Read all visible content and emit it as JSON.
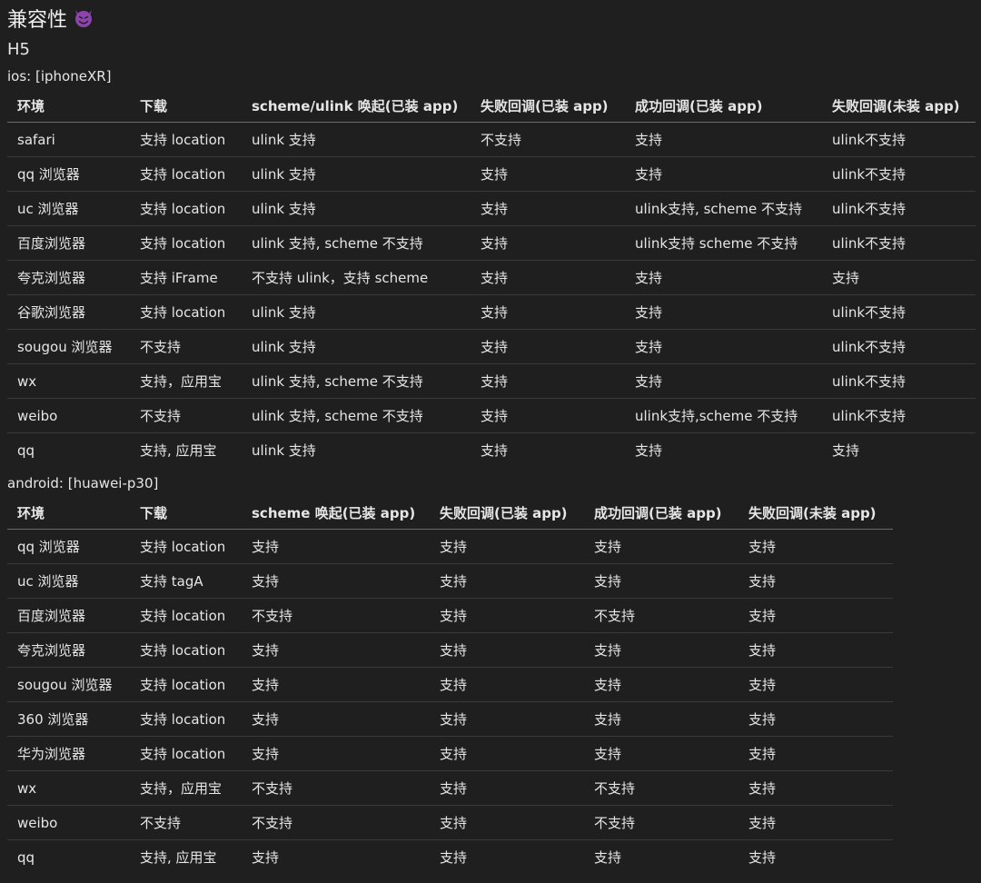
{
  "page": {
    "title": "兼容性",
    "subtitle": "H5"
  },
  "ios": {
    "label": "ios: [iphoneXR]",
    "headers": [
      "环境",
      "下载",
      "scheme/ulink 唤起(已装 app)",
      "失败回调(已装 app)",
      "成功回调(已装 app)",
      "失败回调(未装 app)"
    ],
    "rows": [
      [
        "safari",
        "支持 location",
        "ulink 支持",
        "不支持",
        "支持",
        "ulink不支持"
      ],
      [
        "qq 浏览器",
        "支持 location",
        "ulink 支持",
        "支持",
        "支持",
        "ulink不支持"
      ],
      [
        "uc 浏览器",
        "支持 location",
        "ulink 支持",
        "支持",
        "ulink支持, scheme 不支持",
        "ulink不支持"
      ],
      [
        "百度浏览器",
        "支持 location",
        "ulink 支持, scheme 不支持",
        "支持",
        "ulink支持 scheme 不支持",
        "ulink不支持"
      ],
      [
        "夸克浏览器",
        "支持 iFrame",
        "不支持 ulink，支持 scheme",
        "支持",
        "支持",
        "支持"
      ],
      [
        "谷歌浏览器",
        "支持 location",
        "ulink 支持",
        "支持",
        "支持",
        "ulink不支持"
      ],
      [
        "sougou 浏览器",
        "不支持",
        "ulink 支持",
        "支持",
        "支持",
        "ulink不支持"
      ],
      [
        "wx",
        "支持，应用宝",
        "ulink 支持, scheme 不支持",
        "支持",
        "支持",
        "ulink不支持"
      ],
      [
        "weibo",
        "不支持",
        "ulink 支持, scheme 不支持",
        "支持",
        "ulink支持,scheme 不支持",
        "ulink不支持"
      ],
      [
        "qq",
        "支持, 应用宝",
        "ulink 支持",
        "支持",
        "支持",
        "支持"
      ]
    ]
  },
  "android": {
    "label": "android: [huawei-p30]",
    "headers": [
      "环境",
      "下载",
      "scheme 唤起(已装 app)",
      "失败回调(已装 app)",
      "成功回调(已装 app)",
      "失败回调(未装 app)"
    ],
    "rows": [
      [
        "qq 浏览器",
        "支持 location",
        "支持",
        "支持",
        "支持",
        "支持"
      ],
      [
        "uc 浏览器",
        "支持 tagA",
        "支持",
        "支持",
        "支持",
        "支持"
      ],
      [
        "百度浏览器",
        "支持 location",
        "不支持",
        "支持",
        "不支持",
        "支持"
      ],
      [
        "夸克浏览器",
        "支持 location",
        "支持",
        "支持",
        "支持",
        "支持"
      ],
      [
        "sougou 浏览器",
        "支持 location",
        "支持",
        "支持",
        "支持",
        "支持"
      ],
      [
        "360 浏览器",
        "支持 location",
        "支持",
        "支持",
        "支持",
        "支持"
      ],
      [
        "华为浏览器",
        "支持 location",
        "支持",
        "支持",
        "支持",
        "支持"
      ],
      [
        "wx",
        "支持，应用宝",
        "不支持",
        "支持",
        "不支持",
        "支持"
      ],
      [
        "weibo",
        "不支持",
        "不支持",
        "支持",
        "不支持",
        "支持"
      ],
      [
        "qq",
        "支持, 应用宝",
        "支持",
        "支持",
        "支持",
        "支持"
      ]
    ]
  },
  "icons": {
    "title_icon": "smiling-devil-icon",
    "title_icon_color": "#8e44ad"
  }
}
